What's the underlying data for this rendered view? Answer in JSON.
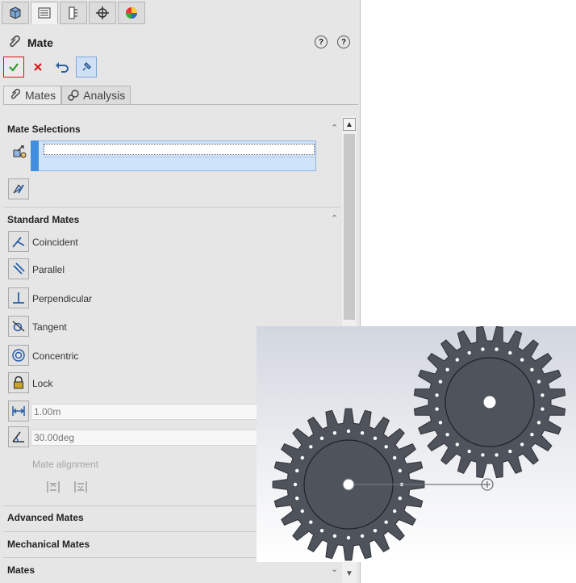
{
  "window": {
    "top_tabs": [
      "feature-manager",
      "property-manager",
      "configuration-manager",
      "dimxpert-manager",
      "display-manager"
    ]
  },
  "header": {
    "title": "Mate",
    "help_label": "?"
  },
  "subtabs": [
    {
      "label": "Mates"
    },
    {
      "label": "Analysis"
    }
  ],
  "sections": {
    "mate_selections": "Mate Selections",
    "standard_mates": "Standard Mates",
    "advanced_mates": "Advanced Mates",
    "mechanical_mates": "Mechanical Mates",
    "mates": "Mates"
  },
  "standard_mates": [
    {
      "label": "Coincident",
      "icon": "coincident-icon"
    },
    {
      "label": "Parallel",
      "icon": "parallel-icon"
    },
    {
      "label": "Perpendicular",
      "icon": "perpendicular-icon"
    },
    {
      "label": "Tangent",
      "icon": "tangent-icon"
    },
    {
      "label": "Concentric",
      "icon": "concentric-icon"
    },
    {
      "label": "Lock",
      "icon": "lock-icon"
    }
  ],
  "distance": {
    "value": "1.00m"
  },
  "angle": {
    "value": "30.00deg"
  },
  "mate_alignment": {
    "label": "Mate alignment"
  },
  "colors": {
    "gear": "#4f535b",
    "selection": "#cfe3fb",
    "accent": "#3f8ee0",
    "ok": "#2a9a2a",
    "cancel": "#d11"
  }
}
